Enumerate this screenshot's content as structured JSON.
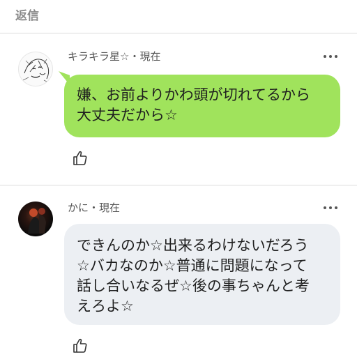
{
  "header": {
    "title": "返信"
  },
  "comments": [
    {
      "author": "キラキラ星☆",
      "time": "現在",
      "meta": "キラキラ星☆・現在",
      "text_lines": [
        "嫌、お前よりかわ頭が切れてるから",
        "大丈夫だから☆"
      ],
      "bubble_color": "#a0e35c"
    },
    {
      "author": "かに",
      "time": "現在",
      "meta": "かに・現在",
      "text_lines": [
        "できんのか☆出来るわけないだろう",
        "☆バカなのか☆普通に問題になって",
        "話し合いなるぜ☆後の事ちゃんと考",
        "えろよ☆"
      ],
      "bubble_color": "#eceff3"
    }
  ],
  "icons": {
    "more": "more-icon",
    "like": "thumbs-up-icon",
    "avatar1": "avatar-sketch",
    "avatar2": "avatar-photo"
  }
}
